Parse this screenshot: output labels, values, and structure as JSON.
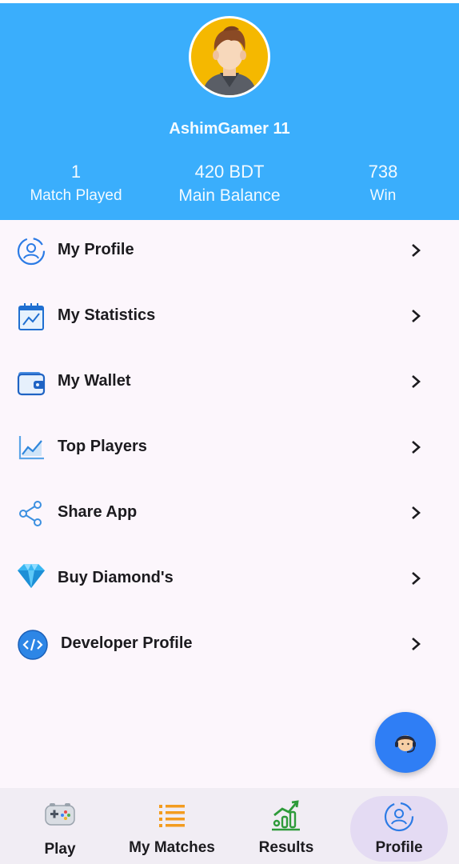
{
  "profile": {
    "username": "AshimGamer 11",
    "stats": [
      {
        "value": "1",
        "label": "Match Played"
      },
      {
        "value": "420 BDT",
        "label": "Main Balance"
      },
      {
        "value": "738",
        "label": "Win"
      }
    ]
  },
  "menu": {
    "items": [
      {
        "label": "My Profile",
        "icon": "user-circle-icon"
      },
      {
        "label": "My Statistics",
        "icon": "statistics-chart-icon"
      },
      {
        "label": "My Wallet",
        "icon": "wallet-icon"
      },
      {
        "label": "Top Players",
        "icon": "trend-chart-icon"
      },
      {
        "label": "Share App",
        "icon": "share-icon"
      },
      {
        "label": "Buy Diamond's",
        "icon": "diamond-icon"
      },
      {
        "label": "Developer Profile",
        "icon": "code-icon"
      }
    ]
  },
  "support_button": {
    "icon": "support-agent-icon"
  },
  "bottom_nav": {
    "items": [
      {
        "label": "Play",
        "icon": "gamepad-icon"
      },
      {
        "label": "My Matches",
        "icon": "list-icon"
      },
      {
        "label": "Results",
        "icon": "bar-chart-icon"
      },
      {
        "label": "Profile",
        "icon": "profile-icon",
        "active": true
      }
    ]
  },
  "colors": {
    "header_bg": "#3aaefc",
    "menu_bg": "#fcf6fc",
    "fab_bg": "#2f7ef5",
    "nav_bg": "#f1edf4",
    "nav_active_pill": "#e4dbf3"
  }
}
